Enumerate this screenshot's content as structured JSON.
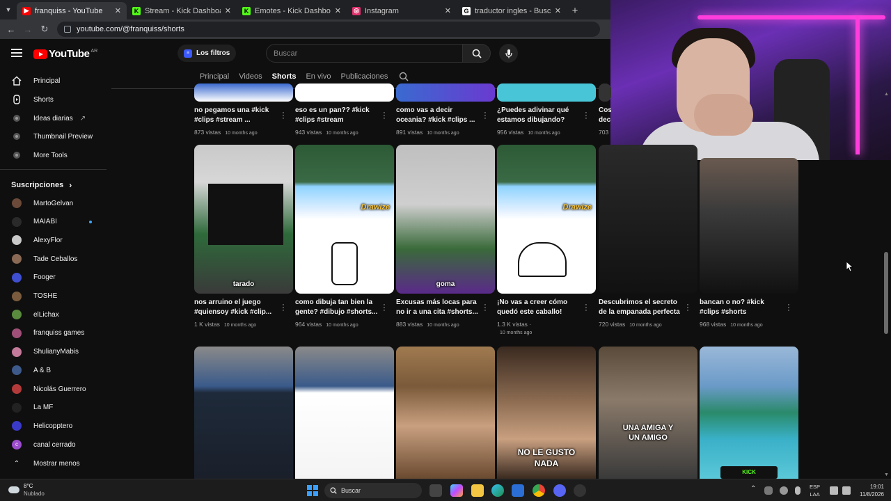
{
  "browser": {
    "tabs": [
      {
        "title": "franquiss - YouTube",
        "color": "#ff0000",
        "glyph": "▶",
        "active": true
      },
      {
        "title": "Stream - Kick Dashboard",
        "color": "#53fc18",
        "glyph": "K",
        "active": false
      },
      {
        "title": "Emotes - Kick Dashboard",
        "color": "#53fc18",
        "glyph": "K",
        "active": false
      },
      {
        "title": "Instagram",
        "color": "#e1306c",
        "glyph": "◎",
        "active": false
      },
      {
        "title": "traductor ingles - Buscar con G",
        "color": "#ffffff",
        "glyph": "G",
        "active": false
      }
    ],
    "new_tab": "+",
    "url": "youtube.com/@franquiss/shorts"
  },
  "header": {
    "logo": "YouTube",
    "country": "AR",
    "filters": "Los filtros",
    "search_placeholder": "Buscar"
  },
  "sidebar": {
    "main": [
      {
        "label": "Principal",
        "icon": "home-icon"
      },
      {
        "label": "Shorts",
        "icon": "shorts-icon"
      },
      {
        "label": "Ideas diarias",
        "icon": "extension-icon",
        "ext": "↗"
      },
      {
        "label": "Thumbnail Preview",
        "icon": "extension-icon"
      },
      {
        "label": "More Tools",
        "icon": "extension-icon"
      }
    ],
    "subs_title": "Suscripciones",
    "subs": [
      {
        "label": "MartoGelvan",
        "color": "#6b4a3a"
      },
      {
        "label": "MAIABI",
        "color": "#2a2a2a",
        "dot": true
      },
      {
        "label": "AlexyFlor",
        "color": "#c9c9c9"
      },
      {
        "label": "Tade Ceballos",
        "color": "#8a6a55"
      },
      {
        "label": "Fooger",
        "color": "#3f4fd0"
      },
      {
        "label": "TOSHE",
        "color": "#7a5b3d"
      },
      {
        "label": "elLichax",
        "color": "#5a8a3d"
      },
      {
        "label": "franquiss games",
        "color": "#a05078"
      },
      {
        "label": "ShulianyMabis",
        "color": "#c47a9a"
      },
      {
        "label": "A & B",
        "color": "#3d5a8a"
      },
      {
        "label": "Nicolás Guerrero",
        "color": "#b33a3a"
      },
      {
        "label": "La MF",
        "color": "#222222"
      },
      {
        "label": "Helicopptero",
        "color": "#3a3ac9"
      },
      {
        "label": "canal cerrado",
        "color": "#9c4dcc",
        "letter": "c"
      }
    ],
    "show_less": "Mostrar menos"
  },
  "channel_tabs": [
    "Principal",
    "Videos",
    "Shorts",
    "En vivo",
    "Publicaciones"
  ],
  "shorts_row1": [
    {
      "title": "no pegamos una  #kick #clips  #stream  ...",
      "views": "873 vistas",
      "ago": "10 months ago"
    },
    {
      "title": "eso es un pan?? #kick #clips #stream",
      "views": "943 vistas",
      "ago": "10 months ago"
    },
    {
      "title": "como vas a decir oceania?  #kick #clips ...",
      "views": "891 vistas",
      "ago": "10 months ago"
    },
    {
      "title": "¿Puedes adivinar qué estamos dibujando?",
      "views": "956 vistas",
      "ago": "10 months ago"
    },
    {
      "title": "Cos dec",
      "views": "703",
      "ago": ""
    }
  ],
  "shorts_row2": [
    {
      "title": "nos arruino el juego #quiensoy  #kick #clip...",
      "views": "1 K vistas",
      "ago": "10 months ago",
      "overlay": "tarado"
    },
    {
      "title": "como dibuja tan bien la gente? #dibujo #shorts...",
      "views": "964 vistas",
      "ago": "10 months ago",
      "overlay": "Drawize"
    },
    {
      "title": "Excusas más locas para no ir a una cita #shorts...",
      "views": "883 vistas",
      "ago": "10 months ago",
      "overlay": "goma"
    },
    {
      "title": "¡No vas a creer cómo quedó este caballo!",
      "views": "1.3 K vistas ·",
      "ago": "10 months ago",
      "overlay": "Drawize"
    },
    {
      "title": "Descubrimos el secreto de la empanada perfecta",
      "views": "720 vistas",
      "ago": "10 months ago",
      "overlay": ""
    },
    {
      "title": "bancan o no? #kick #clips #shorts",
      "views": "968 vistas",
      "ago": "10 months ago",
      "overlay": ""
    }
  ],
  "shorts_row3": [
    {
      "overlay": ""
    },
    {
      "overlay": ""
    },
    {
      "overlay": ""
    },
    {
      "overlay": "NO LE GUSTO NADA"
    },
    {
      "overlay": "UNA AMIGA Y UN AMIGO"
    },
    {
      "overlay": "KICK"
    }
  ],
  "taskbar": {
    "temp": "8°C",
    "weather": "Nublado",
    "search": "Buscar",
    "lang1": "ESP",
    "lang2": "LAA",
    "time": "19:01",
    "date": "11/8/2026"
  }
}
